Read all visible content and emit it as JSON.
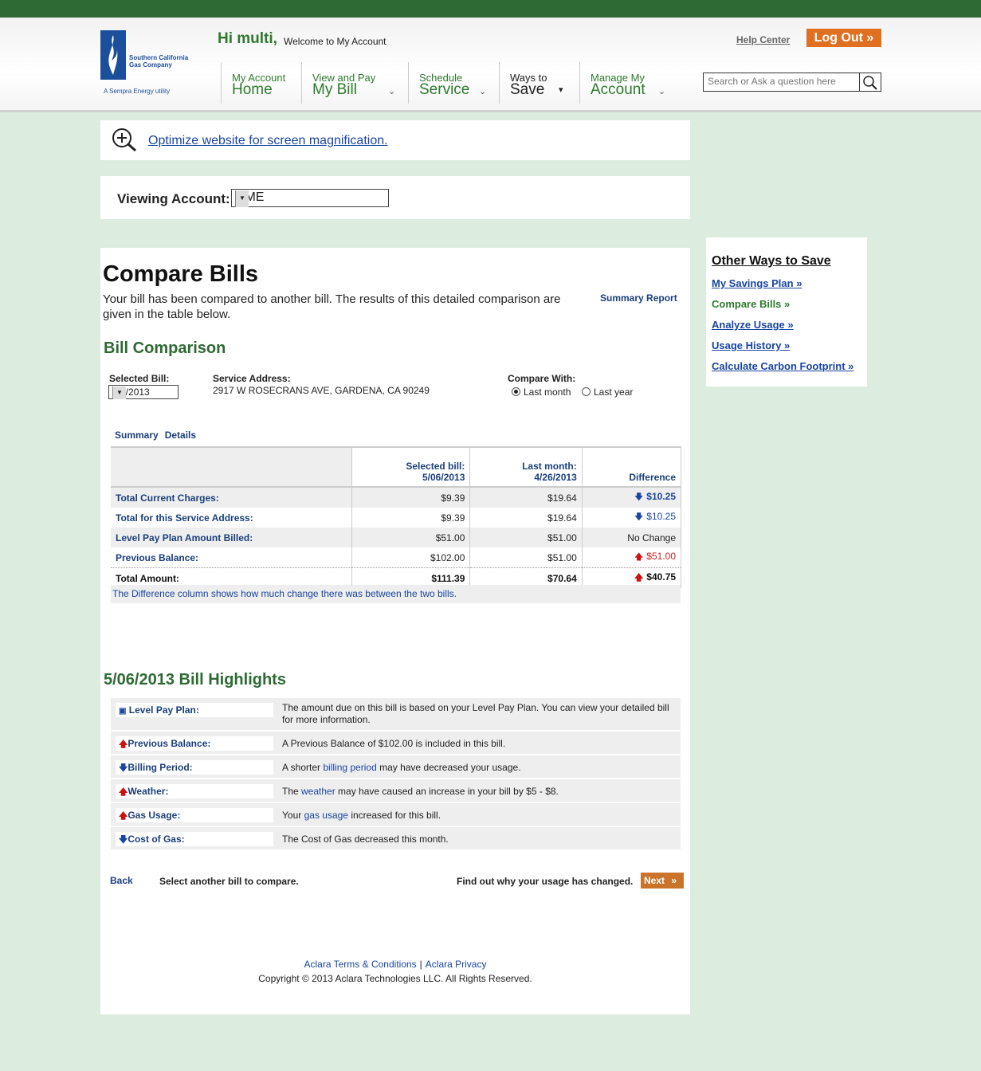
{
  "header": {
    "greeting": "Hi multi,",
    "welcome": "Welcome to My Account",
    "help_center": "Help Center",
    "logout": "Log Out »",
    "search_placeholder": "Search or Ask a question here",
    "logo": {
      "name": "Southern California Gas Company",
      "tagline": "A Sempra Energy utility"
    },
    "nav": [
      {
        "line1": "My Account",
        "line2": "Home"
      },
      {
        "line1": "View and Pay",
        "line2": "My Bill"
      },
      {
        "line1": "Schedule",
        "line2": "Service"
      },
      {
        "line1": "Ways to",
        "line2": "Save"
      },
      {
        "line1": "Manage My",
        "line2": "Account"
      }
    ]
  },
  "magnify": {
    "link": "Optimize website for screen magnification."
  },
  "viewing": {
    "label": "Viewing Account:",
    "value": "GME"
  },
  "main": {
    "title": "Compare Bills",
    "intro": "Your bill has been compared to another bill. The results of this detailed comparison are given in the table below.",
    "summary_report": "Summary Report",
    "comparison_title": "Bill Comparison",
    "selected_bill_label": "Selected Bill:",
    "selected_bill_value": "5/6/2013",
    "service_address_label": "Service Address:",
    "service_address": "2917 W ROSECRANS AVE, GARDENA, CA 90249",
    "compare_with_label": "Compare With:",
    "radio_last_month": "Last month",
    "radio_last_year": "Last year",
    "tabs": [
      "Summary",
      "Details"
    ],
    "table": {
      "col1_l1": "Selected bill:",
      "col1_l2": "5/06/2013",
      "col2_l1": "Last month:",
      "col2_l2": "4/26/2013",
      "col3": "Difference",
      "rows": [
        {
          "label": "Total Current Charges:",
          "selected": "$9.39",
          "last": "$19.64",
          "diff": "$10.25"
        },
        {
          "label": "Total for this Service Address:",
          "selected": "$9.39",
          "last": "$19.64",
          "diff": "$10.25"
        },
        {
          "label": "Level Pay Plan Amount Billed:",
          "selected": "$51.00",
          "last": "$51.00",
          "diff": "No Change"
        },
        {
          "label": "Previous Balance:",
          "selected": "$102.00",
          "last": "$51.00",
          "diff": "$51.00"
        },
        {
          "label": "Total Amount:",
          "selected": "$111.39",
          "last": "$70.64",
          "diff": "$40.75"
        }
      ],
      "note": "The Difference column shows how much change there was between the two bills."
    },
    "highlights_title": "5/06/2013 Bill Highlights",
    "highlights": [
      {
        "label": "Level Pay Plan:",
        "text": "The amount due on this bill is based on your Level Pay Plan. You can view your detailed bill for more information."
      },
      {
        "label": "Previous Balance:",
        "text": "A Previous Balance of $102.00 is included in this bill."
      },
      {
        "label": "Billing Period:",
        "pre": "A shorter ",
        "link": "billing period",
        "post": " may have decreased your usage."
      },
      {
        "label": "Weather:",
        "pre": "The ",
        "link": "weather",
        "post": " may have caused an increase in your bill by $5 - $8."
      },
      {
        "label": "Gas Usage:",
        "pre": "Your ",
        "link": "gas usage",
        "post": " increased for this bill."
      },
      {
        "label": "Cost of Gas:",
        "text": "The Cost of Gas decreased this month."
      }
    ],
    "back": "Back",
    "select_another": "Select another bill to compare.",
    "find_out": "Find out why your usage has changed.",
    "next": "Next",
    "footer_terms": "Aclara Terms & Conditions",
    "footer_privacy": "Aclara Privacy",
    "copyright": "Copyright © 2013 Aclara Technologies LLC. All Rights Reserved."
  },
  "sidebar": {
    "title": "Other Ways to Save",
    "links": [
      "My Savings Plan »",
      "Compare Bills »",
      "Analyze Usage »",
      "Usage History »",
      "Calculate Carbon Footprint »"
    ]
  },
  "colors": {
    "brand_green": "#2e6a33",
    "link_blue": "#1a45a0",
    "accent_orange": "#e07020",
    "background": "#dcede0"
  }
}
